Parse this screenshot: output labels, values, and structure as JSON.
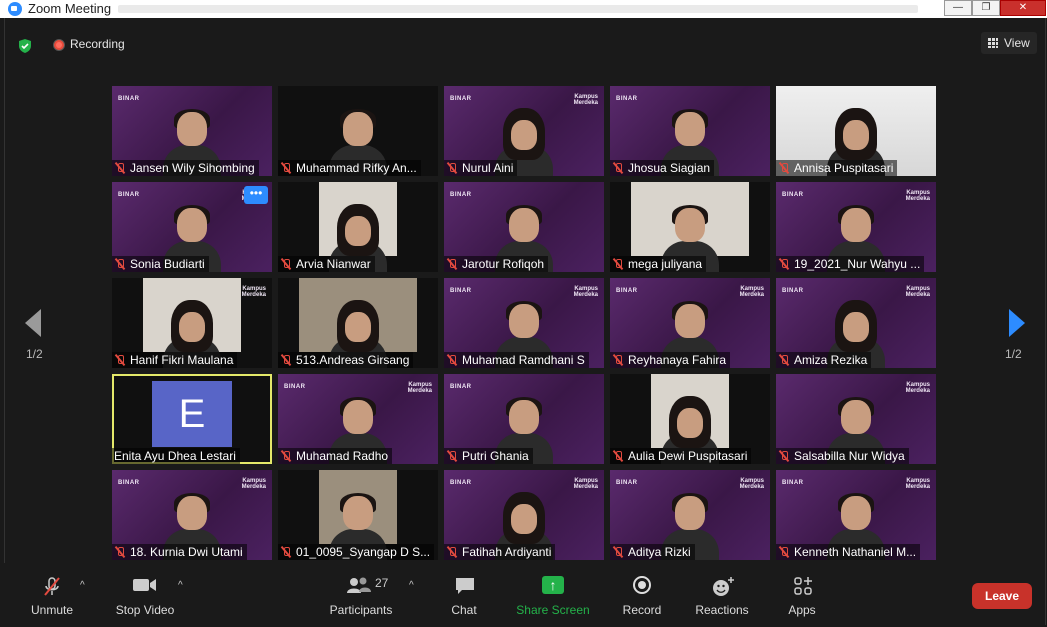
{
  "window": {
    "title": "Zoom Meeting",
    "minimize_glyph": "—",
    "maximize_glyph": "❐",
    "close_glyph": "✕"
  },
  "status": {
    "recording_label": "Recording",
    "view_label": "View"
  },
  "pager": {
    "left_label": "1/2",
    "right_label": "1/2"
  },
  "participants": [
    {
      "name": "Jansen Wily Sihombing",
      "bg": "purple",
      "brand": "BINAR"
    },
    {
      "name": "Muhammad Rifky An...",
      "bg": "black"
    },
    {
      "name": "Nurul Aini",
      "bg": "purple",
      "brand": "BINAR",
      "kampus": true
    },
    {
      "name": "Jhosua Siagian",
      "bg": "purple",
      "brand": "BINAR"
    },
    {
      "name": "Annisa Puspitasari",
      "bg": "white"
    },
    {
      "name": "Sonia Budiarti",
      "bg": "purple",
      "brand": "BINAR",
      "kampus": true,
      "menu": "•••"
    },
    {
      "name": "Arvia Nianwar",
      "bg": "black",
      "inset": true
    },
    {
      "name": "Jarotur Rofiqoh",
      "bg": "purple",
      "brand": "BINAR"
    },
    {
      "name": "mega juliyana",
      "bg": "black",
      "inset": true
    },
    {
      "name": "19_2021_Nur Wahyu ...",
      "bg": "purple",
      "brand": "BINAR",
      "kampus": true
    },
    {
      "name": "Hanif Fikri Maulana",
      "bg": "black",
      "inset": true,
      "kampus": true
    },
    {
      "name": "513.Andreas Girsang",
      "bg": "black",
      "inset": true
    },
    {
      "name": "Muhamad Ramdhani S",
      "bg": "purple",
      "brand": "BINAR",
      "kampus": true
    },
    {
      "name": "Reyhanaya Fahira",
      "bg": "purple",
      "brand": "BINAR",
      "kampus": true
    },
    {
      "name": "Amiza Rezika",
      "bg": "purple",
      "brand": "BINAR",
      "kampus": true
    },
    {
      "name": "Enita Ayu Dhea Lestari",
      "bg": "avatar",
      "initial": "E",
      "active": true,
      "muted": false
    },
    {
      "name": "Muhamad Radho",
      "bg": "purple",
      "brand": "BINAR",
      "kampus": true
    },
    {
      "name": "Putri Ghania",
      "bg": "purple",
      "brand": "BINAR"
    },
    {
      "name": "Aulia Dewi Puspitasari",
      "bg": "black",
      "inset": true
    },
    {
      "name": "Salsabilla Nur Widya",
      "bg": "purple",
      "kampus": true
    },
    {
      "name": "18. Kurnia Dwi Utami",
      "bg": "purple",
      "brand": "BINAR",
      "kampus": true
    },
    {
      "name": "01_0095_Syangap D S...",
      "bg": "black",
      "inset": true
    },
    {
      "name": "Fatihah Ardiyanti",
      "bg": "purple",
      "brand": "BINAR",
      "kampus": true
    },
    {
      "name": "Aditya Rizki",
      "bg": "purple",
      "brand": "BINAR",
      "kampus": true
    },
    {
      "name": "Kenneth Nathaniel M...",
      "bg": "purple",
      "brand": "BINAR",
      "kampus": true
    }
  ],
  "kampus_text": "Kampus\nMerdeka",
  "toolbar": {
    "unmute_label": "Unmute",
    "stop_video_label": "Stop Video",
    "participants_label": "Participants",
    "participants_count": "27",
    "chat_label": "Chat",
    "share_screen_label": "Share Screen",
    "record_label": "Record",
    "reactions_label": "Reactions",
    "apps_label": "Apps",
    "leave_label": "Leave",
    "caret_glyph": "^"
  },
  "colors": {
    "accent": "#2d8cff",
    "share_green": "#24b24a",
    "leave_red": "#c8322a",
    "mute_red": "#e24a3f",
    "active_border": "#e4e96a",
    "avatar_bg": "#5865c7"
  }
}
